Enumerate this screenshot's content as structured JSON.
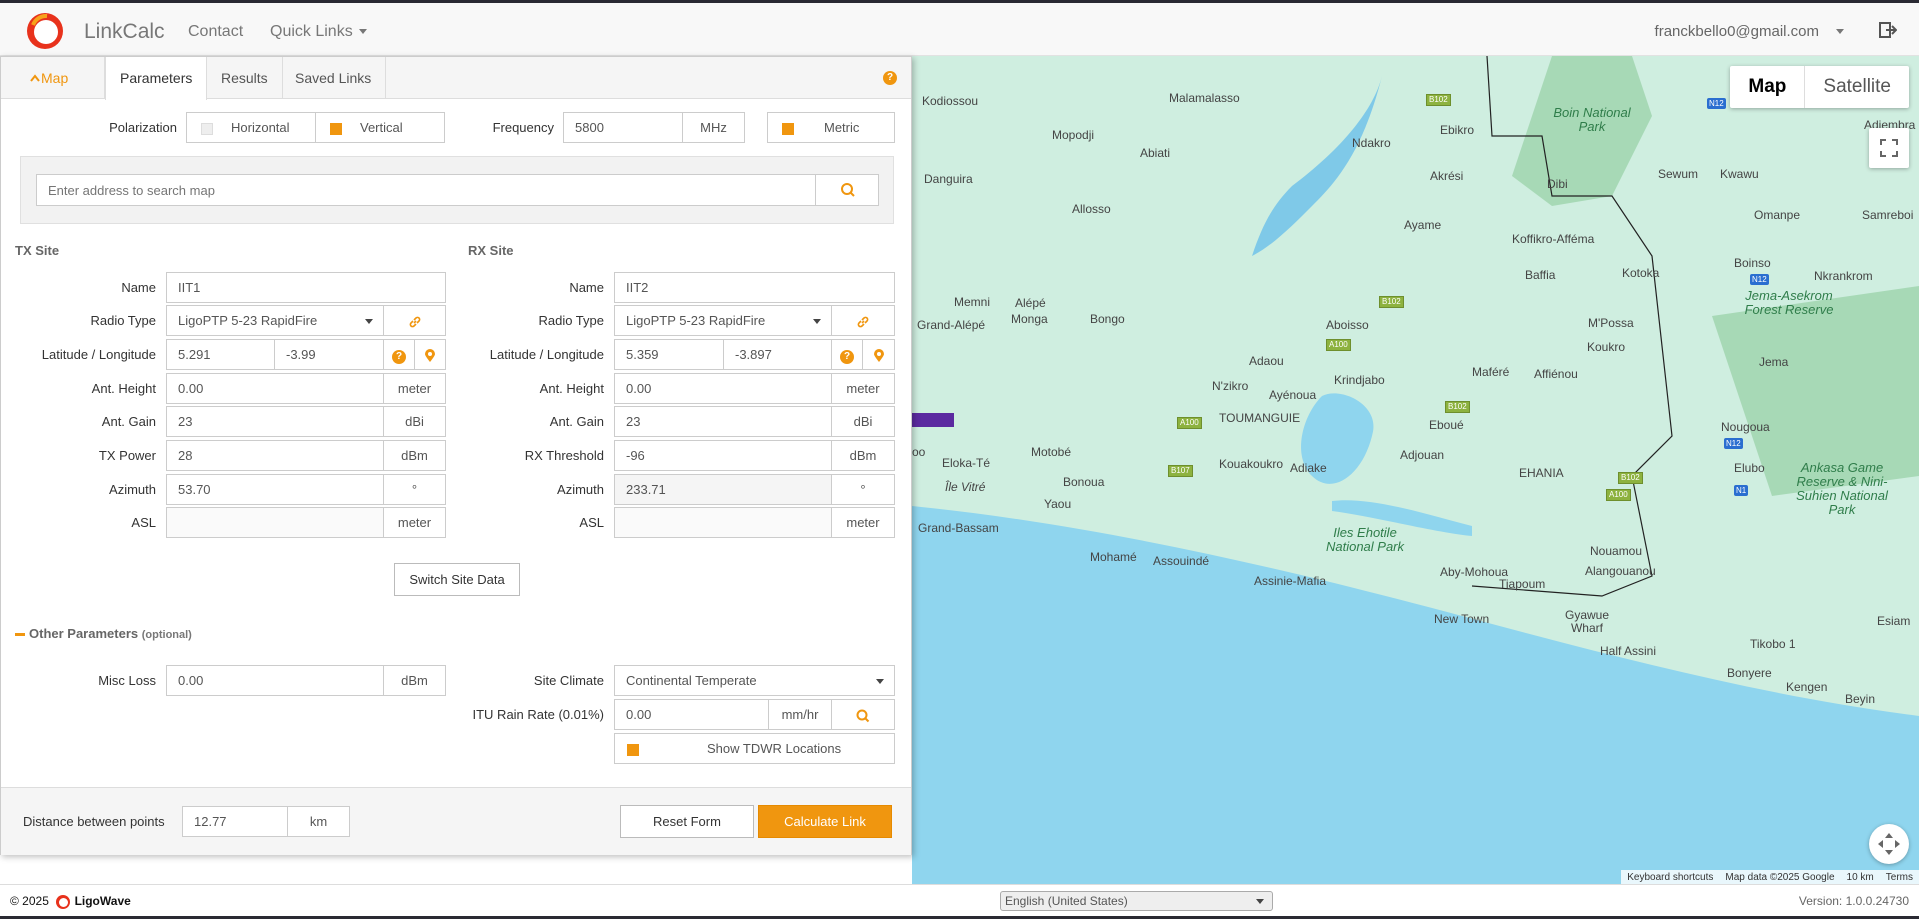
{
  "brand": {
    "name": "LinkCalc",
    "color": "#f0960f"
  },
  "nav": {
    "contact": "Contact",
    "quick_links": "Quick Links",
    "user": "franckbello0@gmail.com"
  },
  "tabs": {
    "map": "Map",
    "parameters": "Parameters",
    "results": "Results",
    "saved": "Saved Links"
  },
  "settings": {
    "polarization_label": "Polarization",
    "horizontal": "Horizontal",
    "vertical": "Vertical",
    "frequency_label": "Frequency",
    "frequency": "5800",
    "frequency_unit": "MHz",
    "metric": "Metric"
  },
  "search": {
    "placeholder": "Enter address to search map"
  },
  "tx": {
    "title": "TX Site",
    "name_label": "Name",
    "name": "IIT1",
    "radio_label": "Radio Type",
    "radio": "LigoPTP 5-23 RapidFire",
    "latlon_label": "Latitude / Longitude",
    "lat": "5.291",
    "lon": "-3.99",
    "height_label": "Ant. Height",
    "height": "0.00",
    "height_unit": "meter",
    "gain_label": "Ant. Gain",
    "gain": "23",
    "gain_unit": "dBi",
    "power_label": "TX Power",
    "power": "28",
    "power_unit": "dBm",
    "azimuth_label": "Azimuth",
    "azimuth": "53.70",
    "azimuth_unit": "°",
    "asl_label": "ASL",
    "asl": "",
    "asl_unit": "meter"
  },
  "rx": {
    "title": "RX Site",
    "name_label": "Name",
    "name": "IIT2",
    "radio_label": "Radio Type",
    "radio": "LigoPTP 5-23 RapidFire",
    "latlon_label": "Latitude / Longitude",
    "lat": "5.359",
    "lon": "-3.897",
    "height_label": "Ant. Height",
    "height": "0.00",
    "height_unit": "meter",
    "gain_label": "Ant. Gain",
    "gain": "23",
    "gain_unit": "dBi",
    "threshold_label": "RX Threshold",
    "threshold": "-96",
    "threshold_unit": "dBm",
    "azimuth_label": "Azimuth",
    "azimuth": "233.71",
    "azimuth_unit": "°",
    "asl_label": "ASL",
    "asl": "",
    "asl_unit": "meter"
  },
  "switch_label": "Switch Site Data",
  "other": {
    "title": "Other Parameters",
    "optional": "(optional)",
    "misc_label": "Misc Loss",
    "misc": "0.00",
    "misc_unit": "dBm",
    "climate_label": "Site Climate",
    "climate": "Continental Temperate",
    "rain_label": "ITU Rain Rate (0.01%)",
    "rain": "0.00",
    "rain_unit": "mm/hr",
    "tdwr": "Show TDWR Locations"
  },
  "footer": {
    "distance_label": "Distance between points",
    "distance": "12.77",
    "distance_unit": "km",
    "reset": "Reset Form",
    "calculate": "Calculate Link"
  },
  "map": {
    "map_btn": "Map",
    "satellite_btn": "Satellite",
    "labels": [
      "Kodiossou",
      "Malamalasso",
      "Mopodji",
      "Abiati",
      "Danguira",
      "Allosso",
      "Ndakro",
      "Ebikro",
      "Akrési",
      "Dibi",
      "Boin National Park",
      "Sewum",
      "Kwawu",
      "Adiembra",
      "Omanpe",
      "Samreboi",
      "Koffikro-Afféma",
      "Ayame",
      "Kotoka",
      "Baffia",
      "Boinso",
      "Nkrankrom",
      "Jema-Asekrom Forest Reserve",
      "Memni",
      "Alépé",
      "Monga",
      "Bongo",
      "Grand-Alépé",
      "Aboisso",
      "Adaou",
      "M'Possa",
      "Koukro",
      "Jema",
      "Maféré",
      "Affiénou",
      "N'zikro",
      "Ayénoua",
      "Krindjabo",
      "TOUMANGUIE",
      "Eboué",
      "Nougoua",
      "Adjouan",
      "Motobé",
      "Eloka-Té",
      "Kouakoukro",
      "Adiake",
      "EHANIA",
      "Elubo",
      "Bonoua",
      "Île Vitré",
      "Yaou",
      "Ankasa Game Reserve & Nini-Suhien National Park",
      "Grand-Bassam",
      "Iles Ehotile National Park",
      "Mohamé",
      "Assouindé",
      "Assinie-Mafia",
      "Aby-Mohoua",
      "Tiapoum",
      "Alangouanou",
      "Nouamou",
      "New Town",
      "Gyawue Wharf",
      "Half Assini",
      "Tikobo 1",
      "Bonyere",
      "Kengen",
      "Beyin",
      "Esiam",
      "oo"
    ],
    "roads": [
      "B102",
      "N12",
      "B102",
      "A100",
      "A100",
      "B107",
      "B102",
      "A100",
      "B102",
      "N12",
      "N1",
      "N12"
    ],
    "attribution": [
      "Keyboard shortcuts",
      "Map data ©2025 Google",
      "10 km",
      "Terms"
    ]
  },
  "page_footer": {
    "copyright": "© 2025",
    "company": "LigoWave",
    "language": "English (United States)",
    "version": "Version: 1.0.0.24730"
  }
}
